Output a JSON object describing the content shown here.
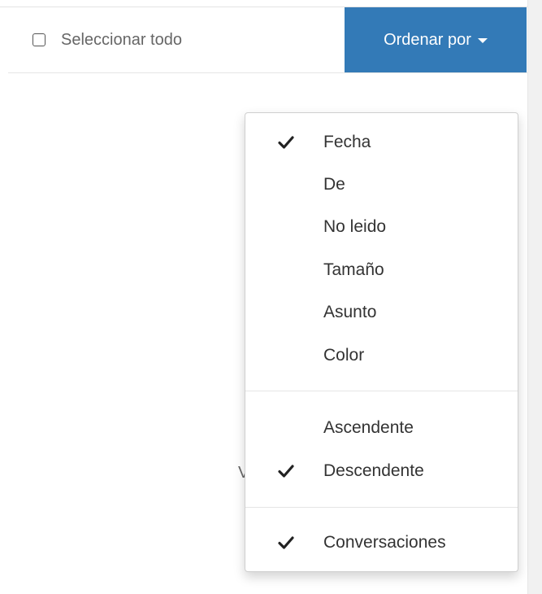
{
  "toolbar": {
    "select_all_label": "Seleccionar todo",
    "sort_button_label": "Ordenar por"
  },
  "background": {
    "partial_text": "V"
  },
  "sort_menu": {
    "fields": [
      {
        "label": "Fecha",
        "checked": true
      },
      {
        "label": "De",
        "checked": false
      },
      {
        "label": "No leido",
        "checked": false
      },
      {
        "label": "Tamaño",
        "checked": false
      },
      {
        "label": "Asunto",
        "checked": false
      },
      {
        "label": "Color",
        "checked": false
      }
    ],
    "order": [
      {
        "label": "Ascendente",
        "checked": false
      },
      {
        "label": "Descendente",
        "checked": true
      }
    ],
    "view": [
      {
        "label": "Conversaciones",
        "checked": true
      }
    ]
  },
  "colors": {
    "accent": "#337ab7"
  },
  "icons": {
    "check": "check-icon",
    "caret": "caret-down-icon"
  }
}
